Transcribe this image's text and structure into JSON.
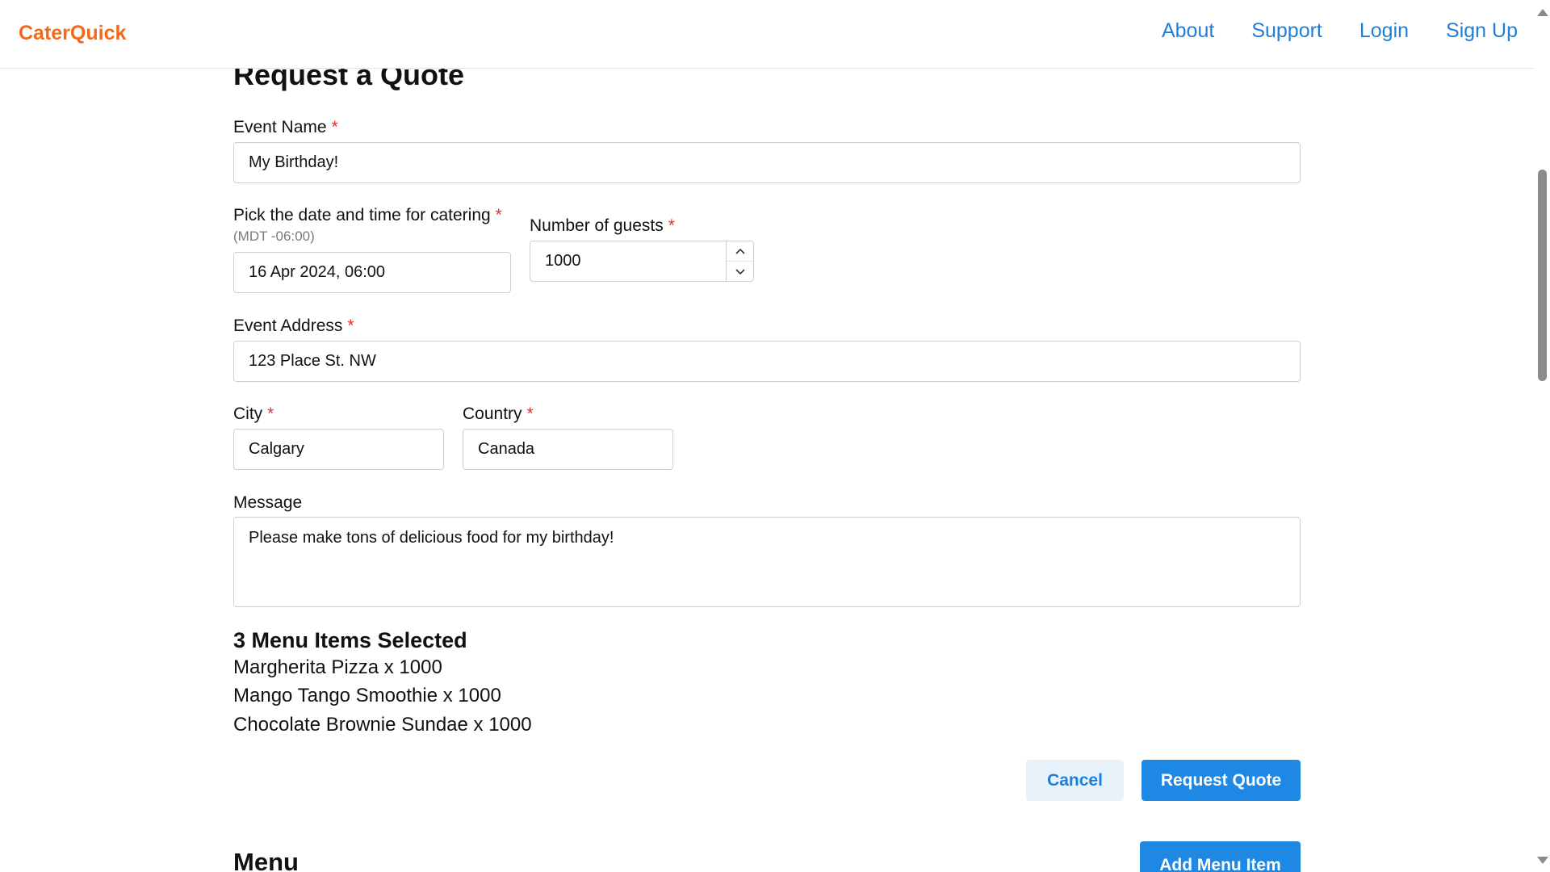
{
  "header": {
    "brand": "CaterQuick",
    "nav": [
      "About",
      "Support",
      "Login",
      "Sign Up"
    ]
  },
  "form": {
    "title": "Request a Quote",
    "required_mark": "*",
    "event_name": {
      "label": "Event Name",
      "value": "My Birthday!"
    },
    "datetime": {
      "label": "Pick the date and time for catering",
      "hint": "(MDT -06:00)",
      "value": "16 Apr 2024, 06:00"
    },
    "guests": {
      "label": "Number of guests",
      "value": "1000"
    },
    "address": {
      "label": "Event Address",
      "value": "123 Place St. NW"
    },
    "city": {
      "label": "City",
      "value": "Calgary"
    },
    "country": {
      "label": "Country",
      "value": "Canada"
    },
    "message": {
      "label": "Message",
      "value": "Please make tons of delicious food for my birthday!"
    }
  },
  "selected": {
    "heading": "3 Menu Items Selected",
    "items": [
      "Margherita Pizza x 1000",
      "Mango Tango Smoothie x 1000",
      "Chocolate Brownie Sundae x 1000"
    ]
  },
  "actions": {
    "cancel": "Cancel",
    "request": "Request Quote"
  },
  "menu": {
    "heading": "Menu",
    "add_button": "Add Menu Item"
  },
  "colors": {
    "brand": "#f26b1d",
    "link": "#1e7fd8",
    "primary": "#1e88e5",
    "required": "#e03131"
  },
  "icons": [
    "chevron-up-icon",
    "chevron-down-icon"
  ]
}
